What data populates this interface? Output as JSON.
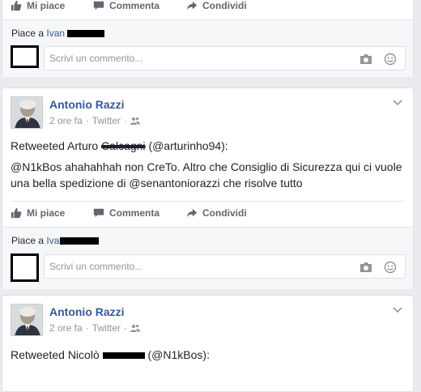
{
  "actions": {
    "like": "Mi piace",
    "comment": "Commenta",
    "share": "Condividi"
  },
  "footer": {
    "likes_prefix": "Piace a",
    "liker": "Ivan",
    "comment_placeholder": "Scrivi un commento..."
  },
  "posts": [
    {
      "author": "Antonio Razzi",
      "time": "2 ore fa",
      "via": "Twitter",
      "retweet_prefix": "Retweeted Arturo",
      "retweet_name_obscured": "Calcagni",
      "retweet_handle": "(@arturinho94):",
      "body": "@N1kBos ahahahhah non CreTo. Altro che Consiglio di Sicurezza qui ci vuole una bella spedizione di @senantoniorazzi che risolve tutto"
    },
    {
      "author": "Antonio Razzi",
      "time": "2 ore fa",
      "via": "Twitter",
      "retweet_prefix": "Retweeted Nicolò",
      "retweet_handle": "(@N1kBos):"
    }
  ],
  "colors": {
    "link": "#365899",
    "background": "#e9ebee",
    "muted": "#90949c"
  }
}
